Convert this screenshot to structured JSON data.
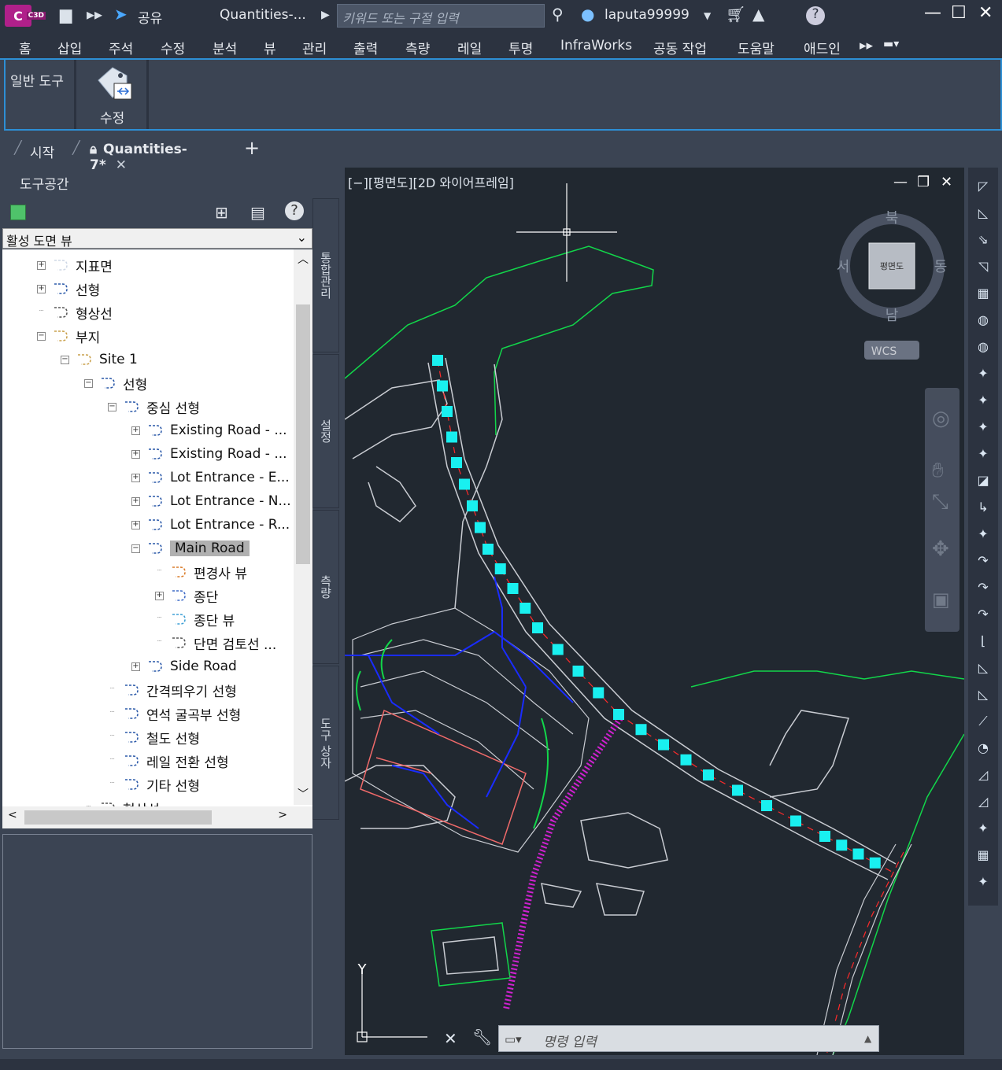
{
  "app": {
    "logo_text": "C",
    "logo_badge": "C3D",
    "share_label": "공유",
    "doc_title": "Quantities-...",
    "search_placeholder": "키워드 또는 구절 입력",
    "user": "laputa99999"
  },
  "menu": [
    "홈",
    "삽입",
    "주석",
    "수정",
    "분석",
    "뷰",
    "관리",
    "출력",
    "측량",
    "레일",
    "투명",
    "InfraWorks",
    "공동 작업",
    "도움말",
    "애드인"
  ],
  "ribbon": {
    "panel_general": "일반 도구",
    "edit_label": "수정"
  },
  "tabs": {
    "start": "시작",
    "active": "Quantities-7*",
    "new": "+"
  },
  "toolspace": {
    "title": "도구공간",
    "view_select": "활성 도면 뷰",
    "tree": [
      {
        "label": "지표면",
        "depth": 1,
        "icon": "surface-icon",
        "expander": "+"
      },
      {
        "label": "선형",
        "depth": 1,
        "icon": "alignment-icon",
        "expander": "+"
      },
      {
        "label": "형상선",
        "depth": 1,
        "icon": "featureline-icon",
        "expander": ""
      },
      {
        "label": "부지",
        "depth": 1,
        "icon": "site-icon",
        "expander": "−"
      },
      {
        "label": "Site 1",
        "depth": 2,
        "icon": "site-icon",
        "expander": "−"
      },
      {
        "label": "선형",
        "depth": 3,
        "icon": "alignment-icon",
        "expander": "−"
      },
      {
        "label": "중심 선형",
        "depth": 4,
        "icon": "alignment-icon",
        "expander": "−"
      },
      {
        "label": "Existing Road - ...",
        "depth": 5,
        "icon": "alignment-icon",
        "expander": "+"
      },
      {
        "label": "Existing Road - ...",
        "depth": 5,
        "icon": "alignment-icon",
        "expander": "+"
      },
      {
        "label": "Lot Entrance - E...",
        "depth": 5,
        "icon": "alignment-icon",
        "expander": "+"
      },
      {
        "label": "Lot Entrance - N...",
        "depth": 5,
        "icon": "alignment-icon",
        "expander": "+"
      },
      {
        "label": "Lot Entrance - R...",
        "depth": 5,
        "icon": "alignment-icon",
        "expander": "+"
      },
      {
        "label": "Main Road",
        "depth": 5,
        "icon": "alignment-icon",
        "expander": "−",
        "selected": true
      },
      {
        "label": "편경사 뷰",
        "depth": 6,
        "icon": "superelevation-icon",
        "expander": ""
      },
      {
        "label": "종단",
        "depth": 6,
        "icon": "profile-icon",
        "expander": "+"
      },
      {
        "label": "종단 뷰",
        "depth": 6,
        "icon": "profileview-icon",
        "expander": ""
      },
      {
        "label": "단면 검토선 ...",
        "depth": 6,
        "icon": "sampleline-icon",
        "expander": ""
      },
      {
        "label": "Side Road",
        "depth": 5,
        "icon": "alignment-icon",
        "expander": "+"
      },
      {
        "label": "간격띄우기 선형",
        "depth": 4,
        "icon": "offset-alignment-icon",
        "expander": ""
      },
      {
        "label": "연석 굴곡부 선형",
        "depth": 4,
        "icon": "curb-return-icon",
        "expander": ""
      },
      {
        "label": "철도 선형",
        "depth": 4,
        "icon": "rail-alignment-icon",
        "expander": ""
      },
      {
        "label": "레일 전환 선형",
        "depth": 4,
        "icon": "rail-turnout-icon",
        "expander": ""
      },
      {
        "label": "기타 선형",
        "depth": 4,
        "icon": "misc-alignment-icon",
        "expander": ""
      },
      {
        "label": "형상선",
        "depth": 3,
        "icon": "featureline-icon",
        "expander": ""
      }
    ]
  },
  "side_tabs": [
    "통합관리",
    "설정",
    "측량",
    "도구 상자"
  ],
  "viewport": {
    "label": "[−][평면도][2D 와이어프레임]",
    "viewcube": {
      "north": "북",
      "south": "남",
      "east": "동",
      "west": "서",
      "face": "평면도",
      "wcs": "WCS"
    },
    "ucs_y": "Y",
    "command_placeholder": "명령 입력"
  },
  "colors": {
    "accent": "#2d8fd5",
    "green": "#12d64a",
    "cyan": "#19f0f0",
    "magenta": "#d021d0",
    "blue": "#1a2cff",
    "road": "#c9ccd2"
  }
}
